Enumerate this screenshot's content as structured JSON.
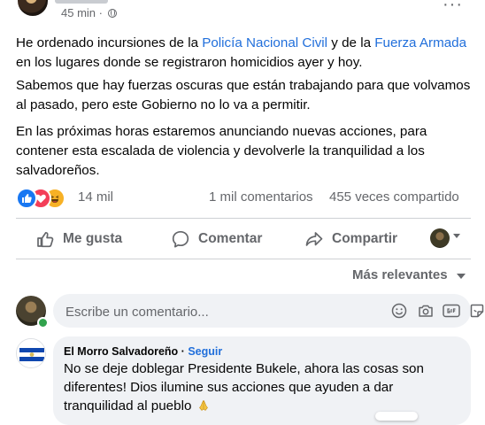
{
  "post": {
    "timestamp": "45 min",
    "privacy_icon": "globe-icon",
    "paragraphs": {
      "p1": {
        "t1": "He ordenado incursiones de la ",
        "link1": "Policía Nacional Civil",
        "t2": " y de la ",
        "link2": "Fuerza Armada",
        "t3": " en los lugares donde se registraron homicidios ayer y hoy."
      },
      "p2": "Sabemos que hay fuerzas oscuras que están trabajando para que volvamos al pasado, pero este Gobierno no lo va a permitir.",
      "p3": "En las próximas horas estaremos anunciando nuevas acciones, para contener esta escalada de violencia y devolverle la tranquilidad a los salvadoreños."
    },
    "reactions": {
      "icons": [
        "like-icon",
        "love-icon",
        "haha-icon"
      ],
      "count": "14 mil",
      "comments": "1 mil comentarios",
      "shares": "455 veces compartido"
    }
  },
  "actions": {
    "like_label": "Me gusta",
    "comment_label": "Comentar",
    "share_label": "Compartir"
  },
  "sort": {
    "label": "Más relevantes"
  },
  "composer": {
    "placeholder": "Escribe un comentario...",
    "icons": [
      "emoji-icon",
      "camera-icon",
      "gif-icon",
      "sticker-icon"
    ]
  },
  "comment": {
    "author": "El Morro Salvadoreño",
    "separator": " · ",
    "follow": "Seguir",
    "text": "No se deje doblegar Presidente Bukele, ahora las cosas son diferentes! Dios ilumine sus acciones que ayuden a dar tranquilidad al pueblo"
  },
  "colors": {
    "link": "#216fdb",
    "secondary_text": "#65676b",
    "like_blue": "#1877f2",
    "love_red": "#f33e58",
    "haha_yellow": "#f7b125"
  }
}
